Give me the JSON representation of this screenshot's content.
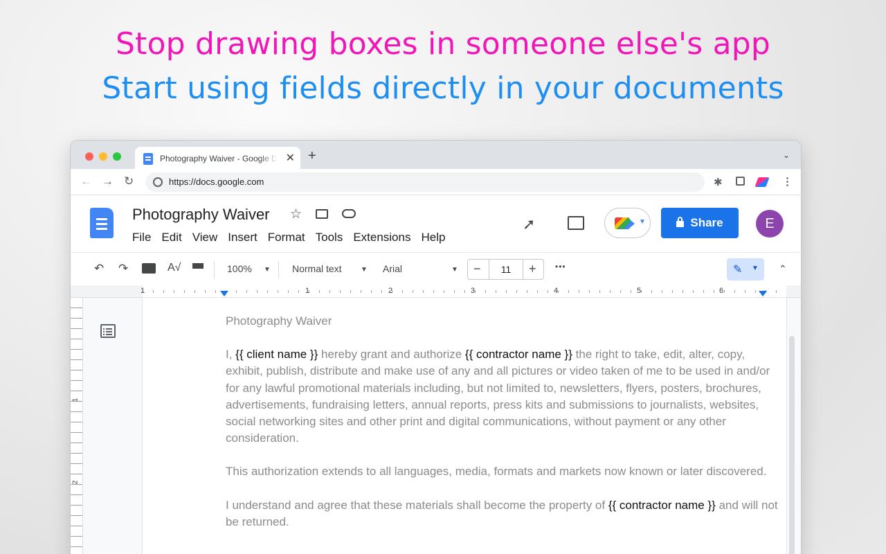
{
  "headline": {
    "line1": "Stop drawing boxes in someone else's app",
    "line2": "Start using fields directly in your documents",
    "line1_color": "#f016b8",
    "line2_color": "#1f8ef1"
  },
  "browser": {
    "tab_title": "Photography Waiver - Google Docs",
    "tab_close": "✕",
    "new_tab": "+",
    "tab_list": "⌄",
    "url": "https://docs.google.com"
  },
  "docs": {
    "title": "Photography Waiver",
    "menu": [
      "File",
      "Edit",
      "View",
      "Insert",
      "Format",
      "Tools",
      "Extensions",
      "Help"
    ],
    "share_label": "Share",
    "avatar_initial": "E",
    "accent": "#1a73e8"
  },
  "toolbar": {
    "zoom": "100%",
    "style": "Normal text",
    "font": "Arial",
    "font_size": "11",
    "more": "•••"
  },
  "ruler": {
    "h_numbers": [
      "1",
      "1",
      "2",
      "3",
      "4",
      "5",
      "6"
    ],
    "v_numbers": [
      "1",
      "2"
    ]
  },
  "document": {
    "heading": "Photography Waiver",
    "p1": {
      "t1": "I, ",
      "f1": "{{ client name }}",
      "t2": " hereby grant and authorize ",
      "f2": "{{ contractor name }}",
      "t3": " the right to take, edit, alter, copy, exhibit, publish, distribute and make use of any and all pictures or video taken of me to be used in and/or for any lawful promotional materials including, but not limited to, newsletters, flyers, posters, brochures, advertisements, fundraising letters, annual reports, press kits and submissions to journalists, websites, social networking sites and other print and digital communications, without payment or any other consideration."
    },
    "p2": "This authorization extends to all languages, media, formats and markets now known or later discovered.",
    "p3": {
      "t1": "I understand and agree that these materials shall become the property of ",
      "f1": "{{ contractor name }}",
      "t2": " and will not be returned."
    }
  }
}
